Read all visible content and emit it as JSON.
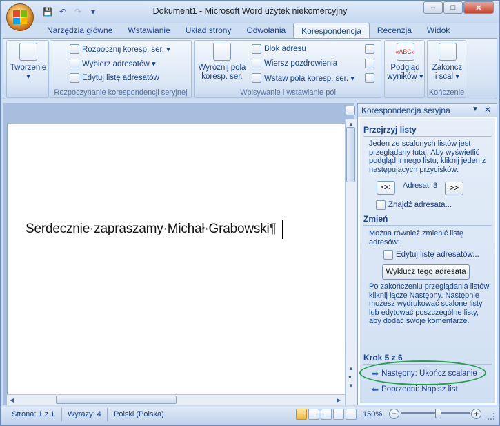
{
  "window": {
    "title": "Dokument1 - Microsoft Word użytek niekomercyjny",
    "minimize": "–",
    "maximize": "□",
    "close": "✕"
  },
  "qat": {
    "save_icon": "save-icon",
    "undo_icon": "undo-icon",
    "redo_icon": "redo-icon",
    "customize_icon": "dropdown-icon"
  },
  "tabs": [
    {
      "label": "Narzędzia główne"
    },
    {
      "label": "Wstawianie"
    },
    {
      "label": "Układ strony"
    },
    {
      "label": "Odwołania"
    },
    {
      "label": "Korespondencja",
      "active": true
    },
    {
      "label": "Recenzja"
    },
    {
      "label": "Widok"
    }
  ],
  "ribbon": {
    "tworzenie": {
      "button": "Tworzenie",
      "arrow": "▾"
    },
    "start_group": {
      "label": "Rozpoczynanie korespondencji seryjnej",
      "rozpocznij": "Rozpocznij koresp. ser. ▾",
      "wybierz": "Wybierz adresatów ▾",
      "edytuj": "Edytuj listę adresatów"
    },
    "fields_group": {
      "label": "Wpisywanie i wstawianie pól",
      "wyroznij_1": "Wyróżnij pola",
      "wyroznij_2": "koresp. ser.",
      "blok": "Blok adresu",
      "wiersz": "Wiersz pozdrowienia",
      "wstaw": "Wstaw pola koresp. ser. ▾"
    },
    "podglad": {
      "line1": "Podgląd",
      "line2": "wyników ▾",
      "icon_text": "«ABC»"
    },
    "zakoncz": {
      "line1": "Zakończ",
      "line2": "i scal ▾",
      "group_label": "Kończenie"
    }
  },
  "document": {
    "text": "Serdecznie·zapraszamy·Michał·Grabowski",
    "pilcrow": "¶"
  },
  "pane": {
    "title": "Korespondencja seryjna",
    "dropdown": "▼",
    "close": "✕",
    "preview_heading": "Przejrzyj listy",
    "preview_text": "Jeden ze scalonych listów jest przeglądany tutaj. Aby wyświetlić podgląd innego listu, kliknij jeden z następujących przycisków:",
    "prev_button": "<<",
    "next_button": ">>",
    "recipient_label": "Adresat: 3",
    "find_link": "Znajdź adresata...",
    "change_heading": "Zmień",
    "change_text": "Można również zmienić listę adresów:",
    "edit_link": "Edytuj listę adresatów...",
    "exclude_button": "Wyklucz tego adresata",
    "after_text": "Po zakończeniu przeglądania listów kliknij łącze Następny. Następnie możesz wydrukować scalone listy lub edytować poszczególne listy, aby dodać swoje komentarze.",
    "step": "Krok 5 z 6",
    "next_link": "Następny: Ukończ scalanie",
    "prev_link": "Poprzedni: Napisz list"
  },
  "status": {
    "page": "Strona: 1 z 1",
    "words": "Wyrazy: 4",
    "language": "Polski (Polska)",
    "zoom": "150%",
    "zoom_minus": "−",
    "zoom_plus": "+"
  },
  "colors": {
    "accent": "#15428b",
    "highlight": "#21a04a",
    "link": "#1d3b86"
  }
}
